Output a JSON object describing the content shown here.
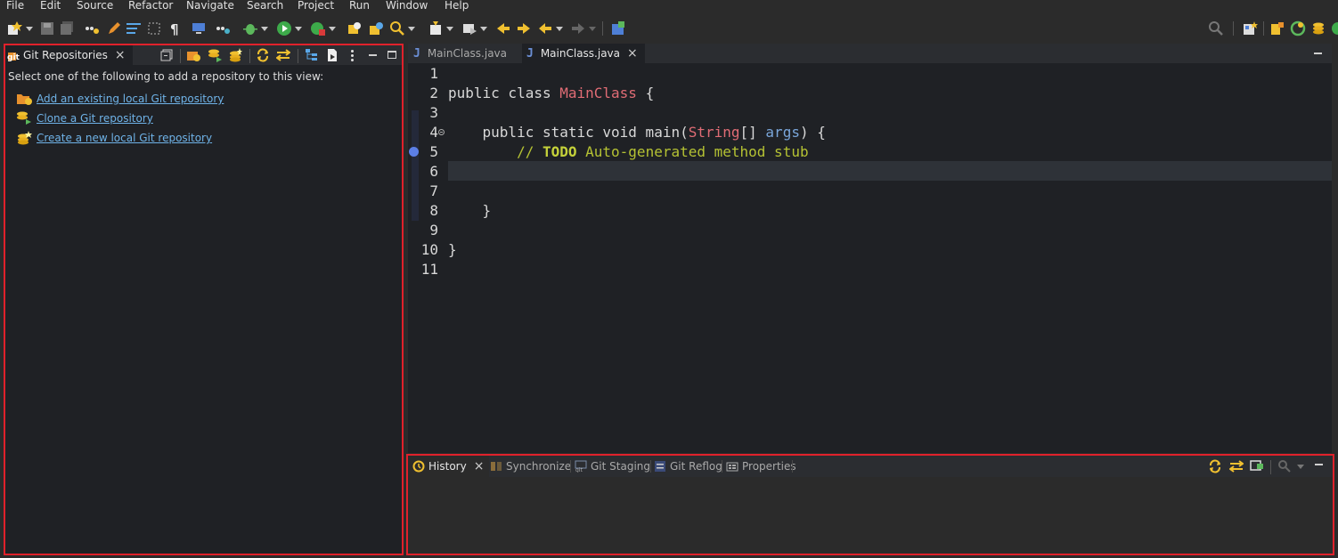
{
  "menubar": {
    "items": [
      "File",
      "Edit",
      "Source",
      "Refactor",
      "Navigate",
      "Search",
      "Project",
      "Run",
      "Window",
      "Help"
    ]
  },
  "toolbar": {
    "icons": [
      "new-icon",
      "save-icon",
      "save-all-icon",
      "build-icon",
      "pen-icon",
      "wrap-icon",
      "select-icon",
      "pilcrow-icon",
      "monitor-icon",
      "java-icon",
      "debug-icon",
      "run-icon",
      "coverage-icon",
      "open-type-icon",
      "open-task-icon",
      "search-icon",
      "annotation-icon",
      "task-list-icon",
      "back-nav-icon",
      "forward-nav-icon",
      "back-icon",
      "forward-icon",
      "perspective-icon"
    ],
    "right_icons": [
      "quick-access-search-icon",
      "open-perspective-icon",
      "java-perspective-icon",
      "git-perspective-icon",
      "team-sync-icon"
    ]
  },
  "git_panel": {
    "tab_label": "Git Repositories",
    "instructions": "Select one of the following to add a repository to this view:",
    "links": [
      {
        "label": "Add an existing local Git repository",
        "icon": "folder-add-icon"
      },
      {
        "label": "Clone a Git repository",
        "icon": "clone-icon"
      },
      {
        "label": "Create a new local Git repository",
        "icon": "create-repo-icon"
      }
    ]
  },
  "editor": {
    "tabs": [
      {
        "label": "MainClass.java",
        "active": false
      },
      {
        "label": "MainClass.java",
        "active": true
      }
    ],
    "line_numbers": [
      "1",
      "2",
      "3",
      "4",
      "5",
      "6",
      "7",
      "8",
      "9",
      "10",
      "11"
    ],
    "code": {
      "l2_kw": "public class ",
      "l2_cls": "MainClass",
      "l2_end": " {",
      "l4_kw": "    public static void main(",
      "l4_type": "String",
      "l4_mid": "[] ",
      "l4_param": "args",
      "l4_end": ") {",
      "l5_cmt": "        // ",
      "l5_todo": "TODO",
      "l5_rest": " Auto-generated method stub",
      "l8": "    }",
      "l10": "}"
    },
    "current_line": 6
  },
  "bottom_panel": {
    "tabs": [
      {
        "label": "History",
        "active": true
      },
      {
        "label": "Synchronize",
        "active": false
      },
      {
        "label": "Git Staging",
        "active": false
      },
      {
        "label": "Git Reflog",
        "active": false
      },
      {
        "label": "Properties",
        "active": false
      }
    ]
  },
  "colors": {
    "panel_border": "#e0212b",
    "link": "#6fb3e8",
    "class_name": "#e06c75",
    "comment": "#b5c233",
    "param": "#7aa6da"
  }
}
